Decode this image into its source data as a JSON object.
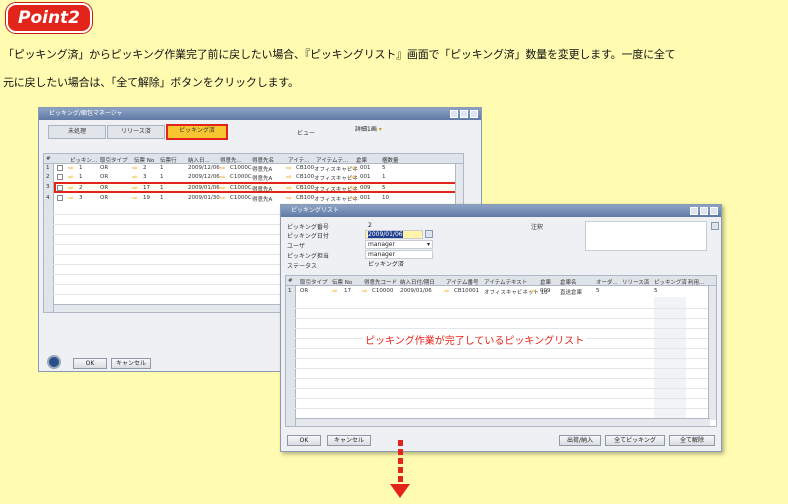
{
  "badge": "Point2",
  "description": {
    "line1": "「ピッキング済」からピッキング作業完了前に戻したい場合、『ピッキングリスト』画面で「ピッキング済」数量を変更します。一度に全て",
    "line2": "元に戻したい場合は、「全て解除」ボタンをクリックします。"
  },
  "manager": {
    "title": "ピッキング/梱包マネージャ",
    "tabs": [
      "未処理",
      "リリース済",
      "ピッキング済"
    ],
    "view_label": "ビュー",
    "view_value": "詳細1画",
    "columns": [
      "#",
      "ピッキン...",
      "取引タイプ",
      "伝票 No",
      "伝票行",
      "納入日...",
      "得意先...",
      "得意先名",
      "アイテ...",
      "アイテムテ...",
      "倉庫",
      "梱数量"
    ],
    "rows": [
      {
        "num": "1",
        "pick": "1",
        "type": "OR",
        "doc": "2",
        "line": "1",
        "date": "2009/12/06",
        "cust": "C1000C",
        "cname": "得意先A",
        "item": "CB100",
        "itext": "オフィスキャビネ",
        "wh": "001",
        "qty": "5"
      },
      {
        "num": "2",
        "pick": "1",
        "type": "OR",
        "doc": "3",
        "line": "1",
        "date": "2009/12/06",
        "cust": "C1000C",
        "cname": "得意先A",
        "item": "CB100",
        "itext": "オフィスキャビネ",
        "wh": "001",
        "qty": "1"
      },
      {
        "num": "3",
        "pick": "2",
        "type": "OR",
        "doc": "17",
        "line": "1",
        "date": "2009/01/06",
        "cust": "C1000C",
        "cname": "得意先A",
        "item": "CB100",
        "itext": "オフィスキャビネ",
        "wh": "009",
        "qty": "5"
      },
      {
        "num": "4",
        "pick": "3",
        "type": "OR",
        "doc": "19",
        "line": "1",
        "date": "2009/01/30",
        "cust": "C1000C",
        "cname": "得意先A",
        "item": "CB100",
        "itext": "オフィスキャビネ",
        "wh": "001",
        "qty": "10"
      }
    ],
    "ok": "OK",
    "cancel": "キャンセル"
  },
  "picklist": {
    "title": "ピッキングリスト",
    "labels": {
      "number": "ピッキング番号",
      "date": "ピッキング日付",
      "user": "ユーザ",
      "owner": "ピッキング担当",
      "status": "ステータス",
      "remarks": "注釈"
    },
    "values": {
      "number": "2",
      "date": "2009/01/06",
      "user": "manager",
      "owner": "manager",
      "status": "ピッキング済"
    },
    "columns": [
      "#",
      "取引タイプ",
      "伝票 No",
      "得意先コード",
      "納入日付/期日",
      "アイテム番号",
      "アイテムテキスト",
      "倉庫",
      "倉庫名",
      "オーダ...",
      "リリース済",
      "ピッキング済",
      "利用..."
    ],
    "row": {
      "num": "1",
      "type": "OR",
      "doc": "17",
      "cust": "C10000",
      "date": "2009/01/06",
      "item": "CB10001",
      "itext": "オフィスキャビネット 10",
      "wh": "009",
      "whname": "直送倉庫",
      "order": "5",
      "released": "",
      "picked": "5"
    },
    "callout": "ピッキング作業が完了しているピッキングリスト",
    "ok": "OK",
    "cancel": "キャンセル",
    "btn_inout": "出荷/納入",
    "btn_pickall": "全てピッキング",
    "btn_releaseall": "全て解除"
  },
  "colors": {
    "accent": "#e3241b",
    "background": "#fffbb0",
    "active_tab": "#f7c530"
  }
}
